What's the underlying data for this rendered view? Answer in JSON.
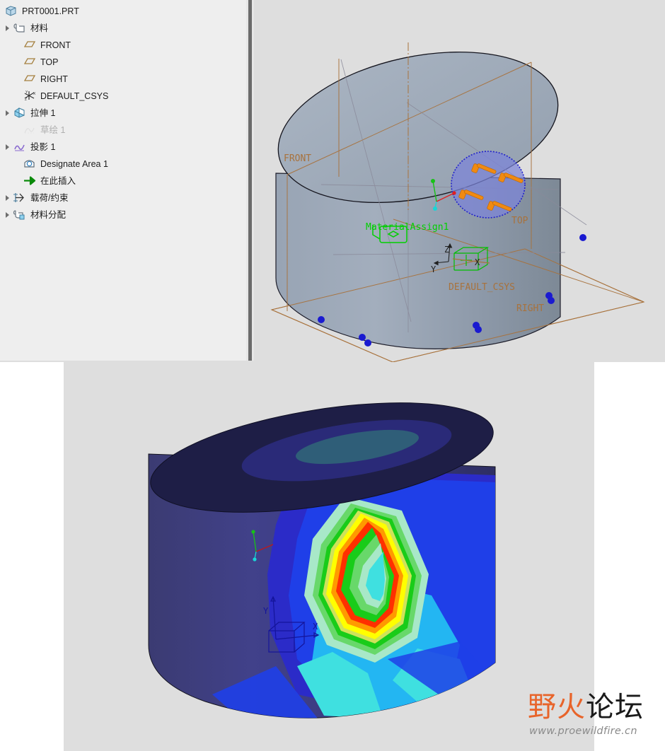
{
  "app": {
    "background_color": "#dedede",
    "panel_color": "#eeeeee"
  },
  "model_tree": {
    "panel_name": "model-tree",
    "scrollbar_visible": true,
    "items": [
      {
        "label": "PRT0001.PRT",
        "icon": "part-icon",
        "expander": false,
        "dimmed": false,
        "indent": 0
      },
      {
        "label": "材料",
        "icon": "material-icon",
        "expander": true,
        "dimmed": false,
        "indent": 0
      },
      {
        "label": "FRONT",
        "icon": "datum-plane-icon",
        "expander": false,
        "dimmed": false,
        "indent": 1
      },
      {
        "label": "TOP",
        "icon": "datum-plane-icon",
        "expander": false,
        "dimmed": false,
        "indent": 1
      },
      {
        "label": "RIGHT",
        "icon": "datum-plane-icon",
        "expander": false,
        "dimmed": false,
        "indent": 1
      },
      {
        "label": "DEFAULT_CSYS",
        "icon": "csys-icon",
        "expander": false,
        "dimmed": false,
        "indent": 1
      },
      {
        "label": "拉伸 1",
        "icon": "extrude-icon",
        "expander": true,
        "dimmed": false,
        "indent": 0
      },
      {
        "label": "草绘 1",
        "icon": "sketch-icon",
        "expander": false,
        "dimmed": true,
        "indent": 1
      },
      {
        "label": "投影 1",
        "icon": "project-icon",
        "expander": true,
        "dimmed": false,
        "indent": 0
      },
      {
        "label": "Designate Area 1",
        "icon": "designate-area-icon",
        "expander": false,
        "dimmed": false,
        "indent": 1
      },
      {
        "label": "在此插入",
        "icon": "insert-here-icon",
        "expander": false,
        "dimmed": false,
        "indent": 1
      },
      {
        "label": "载荷/约束",
        "icon": "load-constraint-icon",
        "expander": true,
        "dimmed": false,
        "indent": 0
      },
      {
        "label": "材料分配",
        "icon": "material-assign-icon",
        "expander": true,
        "dimmed": false,
        "indent": 0
      }
    ]
  },
  "viewport_model": {
    "name": "model-viewport",
    "background_color": "#dedede",
    "part_color": "#9aa7b6",
    "datum_color": "#a8723c",
    "labels": {
      "front_plane": "FRONT",
      "top_plane": "TOP",
      "right_plane": "RIGHT",
      "csys": "DEFAULT_CSYS",
      "material_assign": "MaterialAssign1",
      "axis_x": "X",
      "axis_y": "Y",
      "axis_z": "Z"
    },
    "designated_area": {
      "name": "Designate Area 1",
      "fill_color": "#7b84d8",
      "outline_color": "#2020cc",
      "load_arrow_color": "#f08a12",
      "load_arrow_count": 4
    },
    "constraints": {
      "marker_color": "#1a1ad0",
      "marker_count": 7
    }
  },
  "viewport_fea": {
    "name": "fea-results-viewport",
    "background_color": "#dedede",
    "axis_labels": {
      "x": "X",
      "y": "Y"
    },
    "contour_colors": [
      "#1e1e46",
      "#2a2a78",
      "#2b2bc8",
      "#1f3fe8",
      "#1f6ff0",
      "#23b6f2",
      "#3fe0e0",
      "#a8e8c8",
      "#68d86a",
      "#19cc19",
      "#cfe25a",
      "#ffff00",
      "#ff9a00",
      "#ff3000",
      "#d00000"
    ]
  },
  "watermark": {
    "name": "site-watermark",
    "text_a": "野火",
    "text_b": "论坛",
    "url": "www.proewildfire.cn",
    "accent_color": "#e8642a"
  }
}
